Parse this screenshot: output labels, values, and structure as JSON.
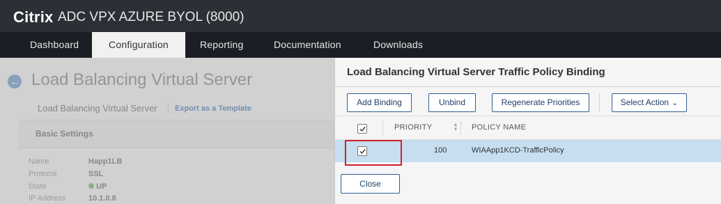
{
  "header": {
    "brand": "Citrix",
    "product": "ADC VPX AZURE BYOL (8000)"
  },
  "nav": {
    "tabs": [
      "Dashboard",
      "Configuration",
      "Reporting",
      "Documentation",
      "Downloads"
    ],
    "active": "Configuration"
  },
  "background_page": {
    "title": "Load Balancing Virtual Server",
    "breadcrumb": "Load Balancing Virtual Server",
    "export_link": "Export as a Template",
    "section_title": "Basic Settings",
    "fields": [
      {
        "label": "Name",
        "value": "Happ1LB"
      },
      {
        "label": "Protocol",
        "value": "SSL"
      },
      {
        "label": "State",
        "value": "UP"
      },
      {
        "label": "IP Address",
        "value": "10.1.0.8"
      }
    ]
  },
  "modal": {
    "title": "Load Balancing Virtual Server Traffic Policy Binding",
    "toolbar": {
      "add_binding": "Add Binding",
      "unbind": "Unbind",
      "regenerate": "Regenerate Priorities",
      "select_action": "Select Action"
    },
    "table": {
      "columns": [
        "PRIORITY",
        "POLICY NAME"
      ],
      "rows": [
        {
          "priority": "100",
          "policy_name": "WIAApp1KCD-TrafficPolicy",
          "checked": true
        }
      ]
    },
    "close_label": "Close"
  },
  "colors": {
    "header_bg": "#2c2f36",
    "nav_bg": "#1b1e24",
    "accent_blue": "#2d5f93",
    "row_selected": "#c6def0",
    "highlight_red": "#d0202a"
  }
}
